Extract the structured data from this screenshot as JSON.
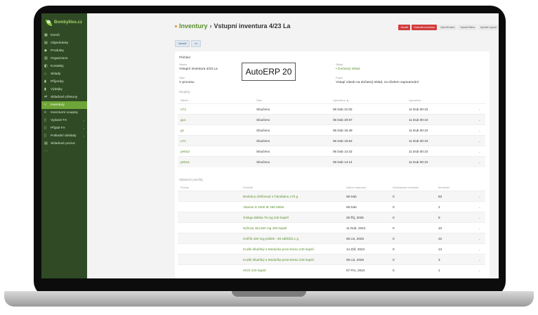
{
  "app": {
    "logo_text": "Bombyllies.cz",
    "watermark": "AutoERP 20"
  },
  "sidebar": {
    "items": [
      {
        "label": "Domů",
        "icon": "grid-icon",
        "chev": ""
      },
      {
        "label": "Objednávky",
        "icon": "cart-icon",
        "chev": ""
      },
      {
        "label": "Produkty",
        "icon": "tag-icon",
        "chev": ""
      },
      {
        "label": "Organizace",
        "icon": "building-icon",
        "chev": ""
      },
      {
        "label": "Kontakty",
        "icon": "contact-icon",
        "chev": ""
      },
      {
        "label": "Sklady",
        "icon": "warehouse-icon",
        "chev": ""
      },
      {
        "label": "Příjemky",
        "icon": "bar-chart-icon",
        "chev": ""
      },
      {
        "label": "Výdejky",
        "icon": "bar-chart-icon",
        "chev": ""
      },
      {
        "label": "Skladové přesuny",
        "icon": "swap-icon",
        "chev": ""
      },
      {
        "label": "Inventury",
        "icon": "list-icon",
        "chev": ""
      },
      {
        "label": "Inventurní soupisy",
        "icon": "list-icon",
        "chev": ""
      },
      {
        "label": "Vydané FA",
        "icon": "document-icon",
        "chev": "›"
      },
      {
        "label": "Přijaté FA",
        "icon": "document-icon",
        "chev": "›"
      },
      {
        "label": "Pokladní doklady",
        "icon": "document-icon",
        "chev": "›"
      },
      {
        "label": "Skladové pozice",
        "icon": "shelf-icon",
        "chev": ""
      },
      {
        "label": "",
        "icon": "more-icon",
        "chev": ""
      }
    ],
    "active_index": 9
  },
  "header": {
    "crumb": "Inventury",
    "separator": "›",
    "title": "Vstupní inventura 4/23 La",
    "actions": [
      "Sloučit",
      "Dokončit inventuru",
      "Vytvořit sken",
      "Upravit fitera",
      "Upravit Layout"
    ],
    "edit_label": "Upravit",
    "more_label": "•••"
  },
  "overview": {
    "section_title": "Přehled",
    "name_label": "Název",
    "name_value": "Vstupní inventura 4/23 La",
    "warehouse_label": "Sklad",
    "warehouse_value": "Dočasný sklad",
    "state_label": "Stav",
    "state_value": "V procesu",
    "desc_label": "Popis",
    "desc_value": "Vstupí zásob na dočasný sklad, za účelem zapoutování"
  },
  "soupisy": {
    "title": "Soupisy",
    "headers": [
      "Název",
      "Stav",
      "Vytvořeno ▲",
      "Upraveno"
    ],
    "rows": [
      {
        "name": "LF2",
        "state": "Sloučeno",
        "created": "06 Dub 21:02",
        "updated": "11 Dub 00:10"
      },
      {
        "name": "gu1",
        "state": "Sloučeno",
        "created": "06 Dub 20:57",
        "updated": "11 Dub 00:10"
      },
      {
        "name": "gn",
        "state": "Sloučeno",
        "created": "06 Dub 16:49",
        "updated": "11 Dub 00:10"
      },
      {
        "name": "LF1",
        "state": "Sloučeno",
        "created": "06 Dub 15:52",
        "updated": "11 Dub 00:10"
      },
      {
        "name": "petra2",
        "state": "Sloučeno",
        "created": "06 Dub 14:42",
        "updated": "11 Dub 00:10"
      },
      {
        "name": "petra1",
        "state": "Sloučeno",
        "created": "06 Dub 14:14",
        "updated": "11 Dub 00:10"
      }
    ]
  },
  "polozky": {
    "title": "Skladové položky",
    "headers": [
      "Pozice",
      "Produkt",
      "Datum expirace",
      "Očekávané množství",
      "Množství"
    ],
    "rows": [
      {
        "product": "Bonbóny ořešnovaí s čokoládou 170 g",
        "exp": "06 Dub",
        "expected": "0",
        "qty": "83"
      },
      {
        "product": "Vitamin D 1000 IE 250 tablet",
        "exp": "06 Dub",
        "expected": "0",
        "qty": "2"
      },
      {
        "product": "Ginkgo Biloba 75 mg 240 kapslí",
        "exp": "25 Říj, 2025",
        "expected": "0",
        "qty": "9"
      },
      {
        "product": "Dýňový olej 500 mg 460 kapslí",
        "exp": "11 Dub, 2024",
        "expected": "0",
        "qty": "10"
      },
      {
        "product": "Hořčík 400 mg prášek - 60 sáčků/2,1 g",
        "exp": "06 Lis, 2025",
        "expected": "0",
        "qty": "22"
      },
      {
        "product": "Kozlík lékařský a Meduňka proti stresu 240 kapslí",
        "exp": "14 Zář, 2024",
        "expected": "0",
        "qty": "13"
      },
      {
        "product": "Kozlík lékařský a Meduňka proti stresu 240 kapslí",
        "exp": "06 Lis, 2025",
        "expected": "0",
        "qty": "3"
      },
      {
        "product": "Hlích 240 kapslí",
        "exp": "07 Pro, 2024",
        "expected": "0",
        "qty": "1"
      }
    ]
  },
  "icons": {
    "caret": "⌄"
  }
}
